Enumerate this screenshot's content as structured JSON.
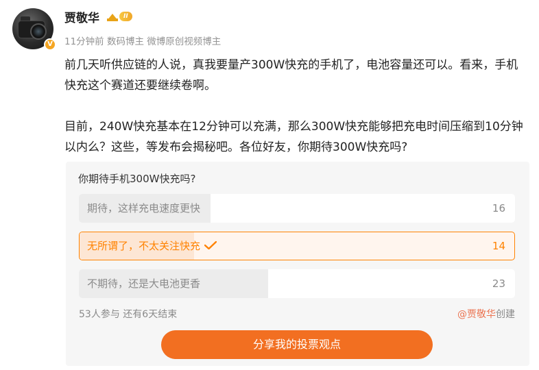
{
  "author": {
    "name": "贾敬华",
    "vip_level": "II",
    "verify_mark": "V",
    "avatar_icon": "camera-avatar"
  },
  "meta": {
    "time": "11分钟前",
    "tags": "数码博主 微博原创视频博主"
  },
  "post": {
    "paragraph1": "前几天听供应链的人说，真我要量产300W快充的手机了，电池容量还可以。看来，手机快充这个赛道还要继续卷啊。",
    "paragraph2": "目前，240W快充基本在12分钟可以充满，那么300W快充能够把充电时间压缩到10分钟以内么？这些，等发布会揭秘吧。各位好友，你期待300W快充吗?"
  },
  "poll": {
    "title": "你期待手机300W快充吗?",
    "options": [
      {
        "label": "期待，这样充电速度更快",
        "count": "16",
        "share": 0.302,
        "selected": false
      },
      {
        "label": "无所谓了，不太关注快充",
        "count": "14",
        "share": 0.264,
        "selected": true
      },
      {
        "label": "不期待，还是大电池更香",
        "count": "23",
        "share": 0.434,
        "selected": false
      }
    ],
    "participants": "53人参与",
    "remaining": "还有6天结束",
    "creator_name": "@贾敬华",
    "creator_suffix": "创建",
    "share_label": "分享我的投票观点"
  },
  "colors": {
    "accent": "#ff8200",
    "share_button": "#f26f21",
    "creator_link": "#eb7350",
    "vip_gold": "#e8a317"
  }
}
